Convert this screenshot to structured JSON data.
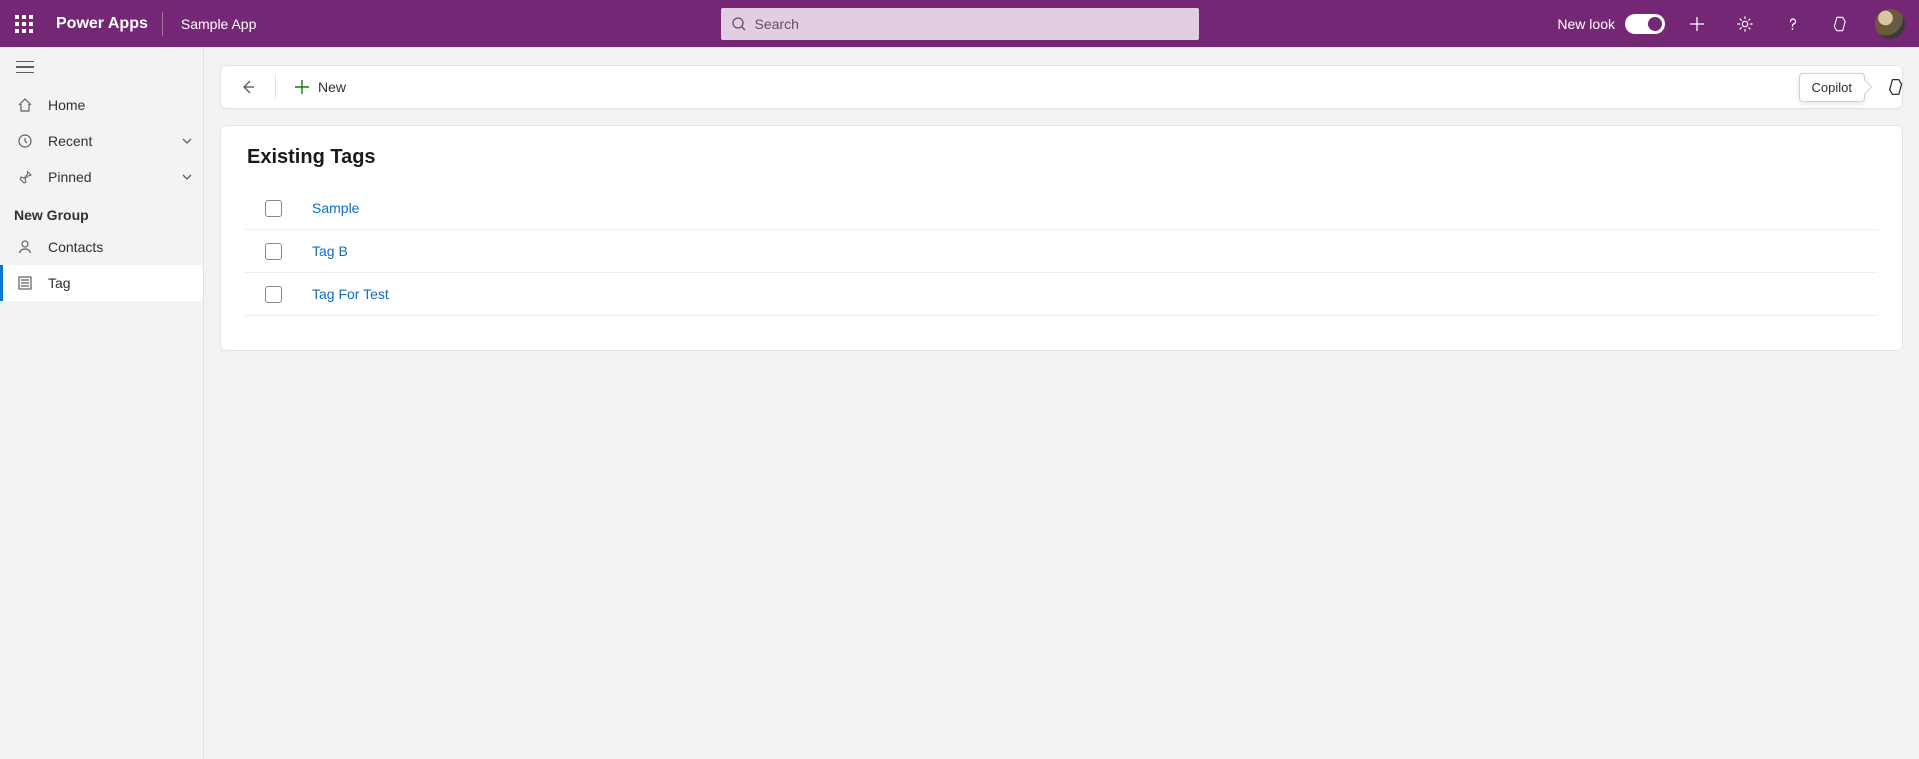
{
  "header": {
    "app_name": "Power Apps",
    "breadcrumb": "Sample App",
    "search_placeholder": "Search",
    "new_look_label": "New look"
  },
  "sidebar": {
    "items": [
      {
        "label": "Home",
        "icon": "home",
        "expandable": false
      },
      {
        "label": "Recent",
        "icon": "clock",
        "expandable": true
      },
      {
        "label": "Pinned",
        "icon": "pin",
        "expandable": true
      }
    ],
    "group_label": "New Group",
    "group_items": [
      {
        "label": "Contacts",
        "icon": "person",
        "active": false
      },
      {
        "label": "Tag",
        "icon": "list",
        "active": true
      }
    ]
  },
  "commandbar": {
    "new_label": "New"
  },
  "copilot": {
    "tooltip": "Copilot"
  },
  "main": {
    "section_title": "Existing Tags",
    "rows": [
      {
        "name": "Sample"
      },
      {
        "name": "Tag B"
      },
      {
        "name": "Tag For Test"
      }
    ]
  }
}
